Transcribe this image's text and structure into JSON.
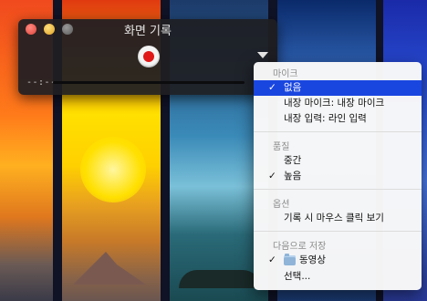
{
  "window": {
    "title": "화면 기록",
    "time_display": "--:--"
  },
  "menu": {
    "microphone": {
      "header": "마이크",
      "items": [
        {
          "label": "없음",
          "checked": true,
          "highlighted": true
        },
        {
          "label": "내장 마이크: 내장 마이크",
          "checked": false
        },
        {
          "label": "내장 입력: 라인 입력",
          "checked": false
        }
      ]
    },
    "quality": {
      "header": "품질",
      "items": [
        {
          "label": "중간",
          "checked": false
        },
        {
          "label": "높음",
          "checked": true
        }
      ]
    },
    "options": {
      "header": "옵션",
      "items": [
        {
          "label": "기록 시 마우스 클릭 보기",
          "checked": false
        }
      ]
    },
    "save_to": {
      "header": "다음으로 저장",
      "items": [
        {
          "label": "동영상",
          "checked": true,
          "icon": "folder-icon"
        },
        {
          "label": "선택...",
          "checked": false
        }
      ]
    },
    "check_glyph": "✓"
  },
  "colors": {
    "highlight": "#1a46e0",
    "record_red": "#e01818"
  }
}
